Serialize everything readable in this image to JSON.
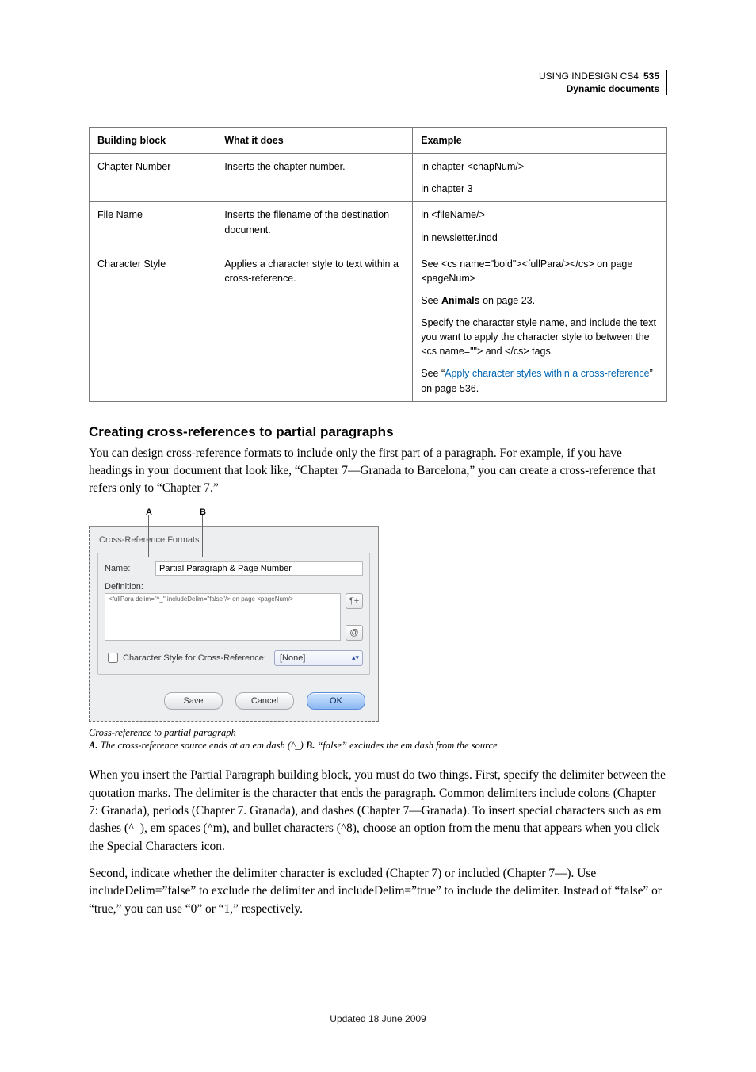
{
  "running_head": {
    "title": "USING INDESIGN CS4",
    "page_no": "535",
    "section": "Dynamic documents"
  },
  "table": {
    "headers": {
      "h1": "Building block",
      "h2": "What it does",
      "h3": "Example"
    },
    "row_chapnum": {
      "name": "Chapter Number",
      "desc": "Inserts the chapter number.",
      "ex1": "in chapter <chapNum/>",
      "ex2": "in chapter 3"
    },
    "row_filename": {
      "name": "File Name",
      "desc": "Inserts the filename of the destination document.",
      "ex1": "in <fileName/>",
      "ex2": "in newsletter.indd"
    },
    "row_charstyle": {
      "name": "Character Style",
      "desc": "Applies a character style to text within a cross-reference.",
      "ex1": "See <cs name=\"bold\"><fullPara/></cs> on page <pageNum>",
      "ex2_pre": "See ",
      "ex2_bold": "Animals",
      "ex2_post": " on page 23.",
      "ex3": "Specify the character style name, and include the text you want to apply the character style to between the <cs name=\"\"> and </cs> tags.",
      "ex4_pre": "See “",
      "ex4_link": "Apply character styles within a cross-reference",
      "ex4_post": "” on page 536."
    }
  },
  "section_heading": "Creating cross-references to partial paragraphs",
  "para_intro": "You can design cross-reference formats to include only the first part of a paragraph. For example, if you have headings in your document that look like, “Chapter 7—Granada to Barcelona,” you can create a cross-reference that refers only to “Chapter 7.”",
  "callout_labels": {
    "A": "A",
    "B": "B"
  },
  "dialog": {
    "panel_title": "Cross-Reference Formats",
    "name_label": "Name:",
    "name_value": "Partial Paragraph & Page Number",
    "definition_label": "Definition:",
    "definition_value": "<fullPara delim=\"^_\" includeDelim=\"false\"/> on page <pageNum/>",
    "cs_label": "Character Style for Cross-Reference:",
    "cs_value": "[None]",
    "btn_save": "Save",
    "btn_cancel": "Cancel",
    "btn_ok": "OK"
  },
  "caption": {
    "line1": "Cross-reference to partial paragraph",
    "A_label": "A.",
    "A_text": " The cross-reference source ends at an em dash (^_)  ",
    "B_label": "B.",
    "B_text": " “false” excludes the em dash from the source"
  },
  "para_after1": "When you insert the Partial Paragraph building block, you must do two things. First, specify the delimiter between the quotation marks. The delimiter is the character that ends the paragraph. Common delimiters include colons (Chapter 7: Granada), periods (Chapter 7. Granada), and dashes (Chapter 7—Granada). To insert special characters such as em dashes (^_), em spaces (^m), and bullet characters (^8), choose an option from the menu that appears when you click the Special Characters icon.",
  "para_after2": "Second, indicate whether the delimiter character is excluded (Chapter 7) or included (Chapter 7—). Use includeDelim=”false” to exclude the delimiter and includeDelim=”true” to include the delimiter. Instead of “false” or “true,” you can use “0” or “1,” respectively.",
  "footer": "Updated 18 June 2009"
}
